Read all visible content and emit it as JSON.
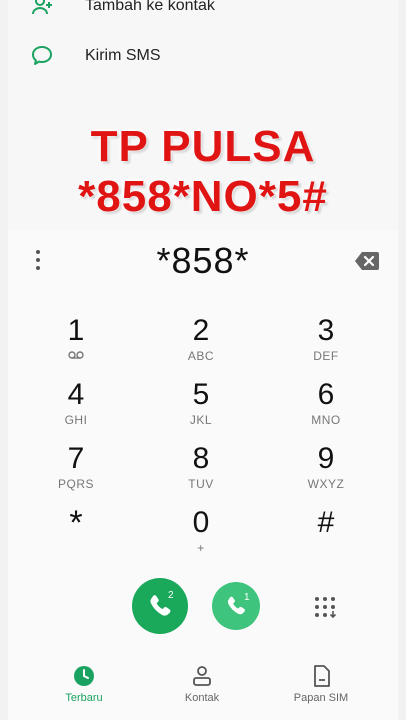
{
  "menu": {
    "items": [
      {
        "label": "Tambah ke kontak",
        "icon": "add-contact-icon"
      },
      {
        "label": "Kirim SMS",
        "icon": "message-icon"
      }
    ]
  },
  "overlay": {
    "line1": "TP PULSA",
    "line2": "*858*NO*5#",
    "color": "#e11414"
  },
  "dialer": {
    "number": "*858*",
    "keys": [
      {
        "digit": "1",
        "letters": "",
        "icon": "voicemail-icon"
      },
      {
        "digit": "2",
        "letters": "ABC"
      },
      {
        "digit": "3",
        "letters": "DEF"
      },
      {
        "digit": "4",
        "letters": "GHI"
      },
      {
        "digit": "5",
        "letters": "JKL"
      },
      {
        "digit": "6",
        "letters": "MNO"
      },
      {
        "digit": "7",
        "letters": "PQRS"
      },
      {
        "digit": "8",
        "letters": "TUV"
      },
      {
        "digit": "9",
        "letters": "WXYZ"
      },
      {
        "digit": "*",
        "letters": ""
      },
      {
        "digit": "0",
        "letters": "+"
      },
      {
        "digit": "#",
        "letters": ""
      }
    ],
    "call_sim2_badge": "2",
    "call_sim1_badge": "1"
  },
  "nav": {
    "items": [
      {
        "label": "Terbaru",
        "icon": "clock-icon",
        "active": true
      },
      {
        "label": "Kontak",
        "icon": "person-icon",
        "active": false
      },
      {
        "label": "Papan SIM",
        "icon": "sim-card-icon",
        "active": false
      }
    ]
  },
  "colors": {
    "accent": "#1aa260",
    "call_primary": "#1aa95a",
    "call_secondary": "#3ec47c"
  }
}
